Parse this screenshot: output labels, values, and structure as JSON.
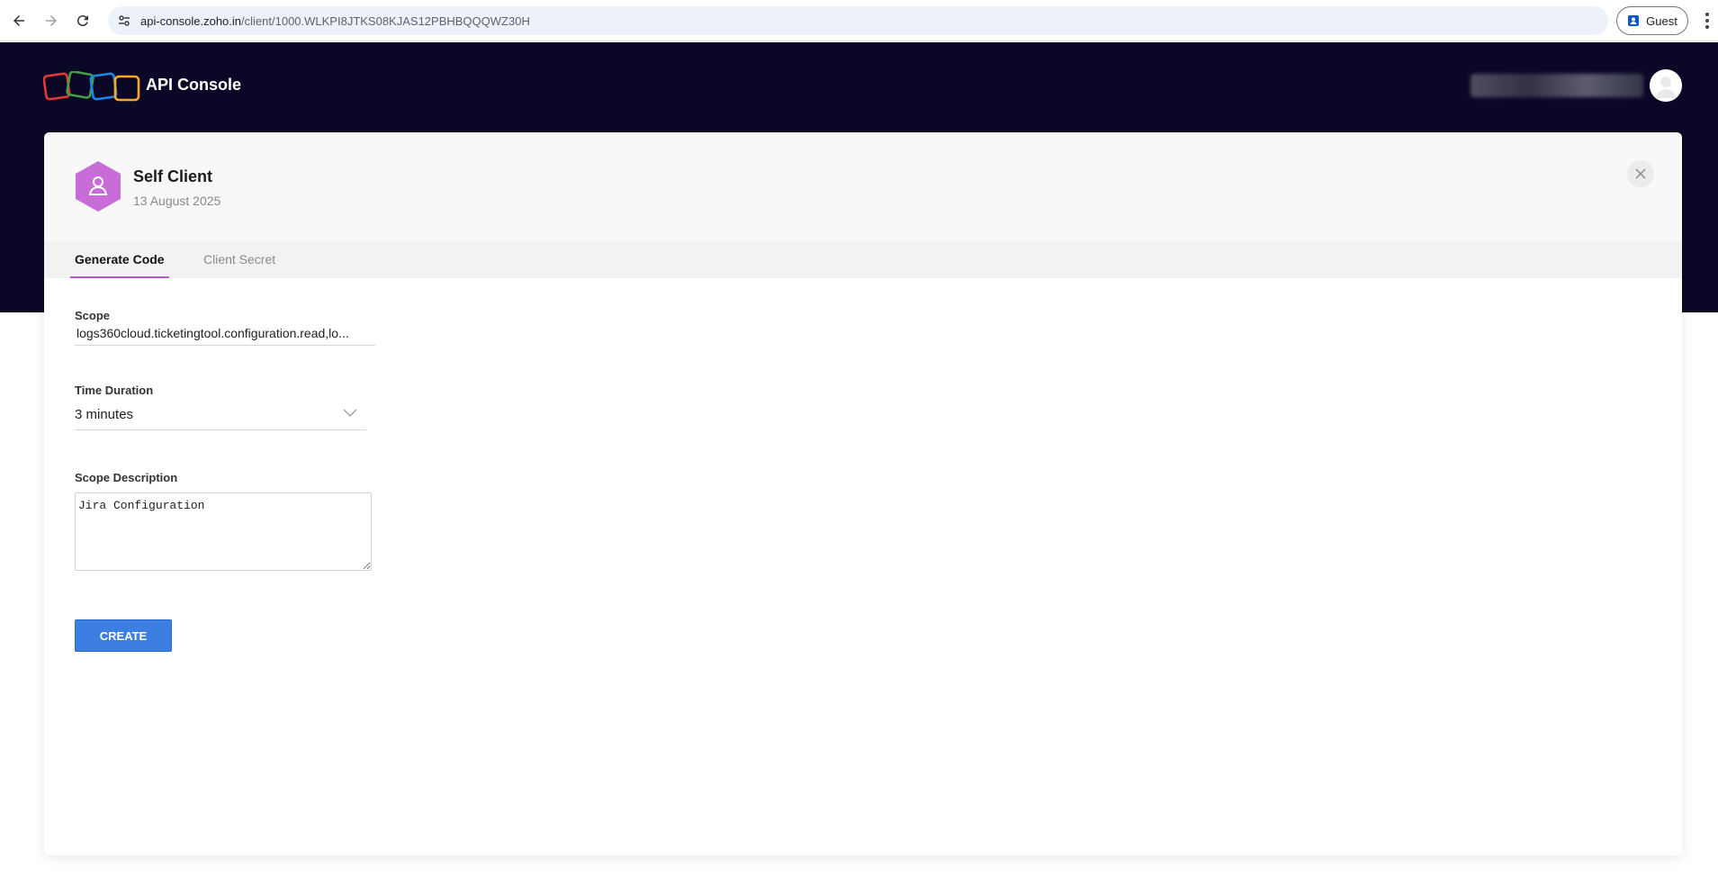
{
  "browser": {
    "url_host": "api-console.zoho.in",
    "url_path": "/client/1000.WLKPI8JTKS08KJAS12PBHBQQQWZ30H",
    "profile_label": "Guest"
  },
  "header": {
    "brand_title": "API Console",
    "logo_colors": [
      "#e53935",
      "#43a047",
      "#1e88e5",
      "#f9a825"
    ],
    "banner_color": "#0b0827"
  },
  "client": {
    "name": "Self Client",
    "date": "13 August 2025",
    "icon_color": "#c86dd7"
  },
  "tabs": [
    {
      "label": "Generate Code",
      "active": true
    },
    {
      "label": "Client Secret",
      "active": false
    }
  ],
  "form": {
    "scope_label": "Scope",
    "scope_value": "logs360cloud.ticketingtool.configuration.read,lo...",
    "duration_label": "Time Duration",
    "duration_value": "3 minutes",
    "description_label": "Scope Description",
    "description_value": "Jira Configuration",
    "create_label": "CREATE",
    "accent_color": "#3d7fe0"
  }
}
